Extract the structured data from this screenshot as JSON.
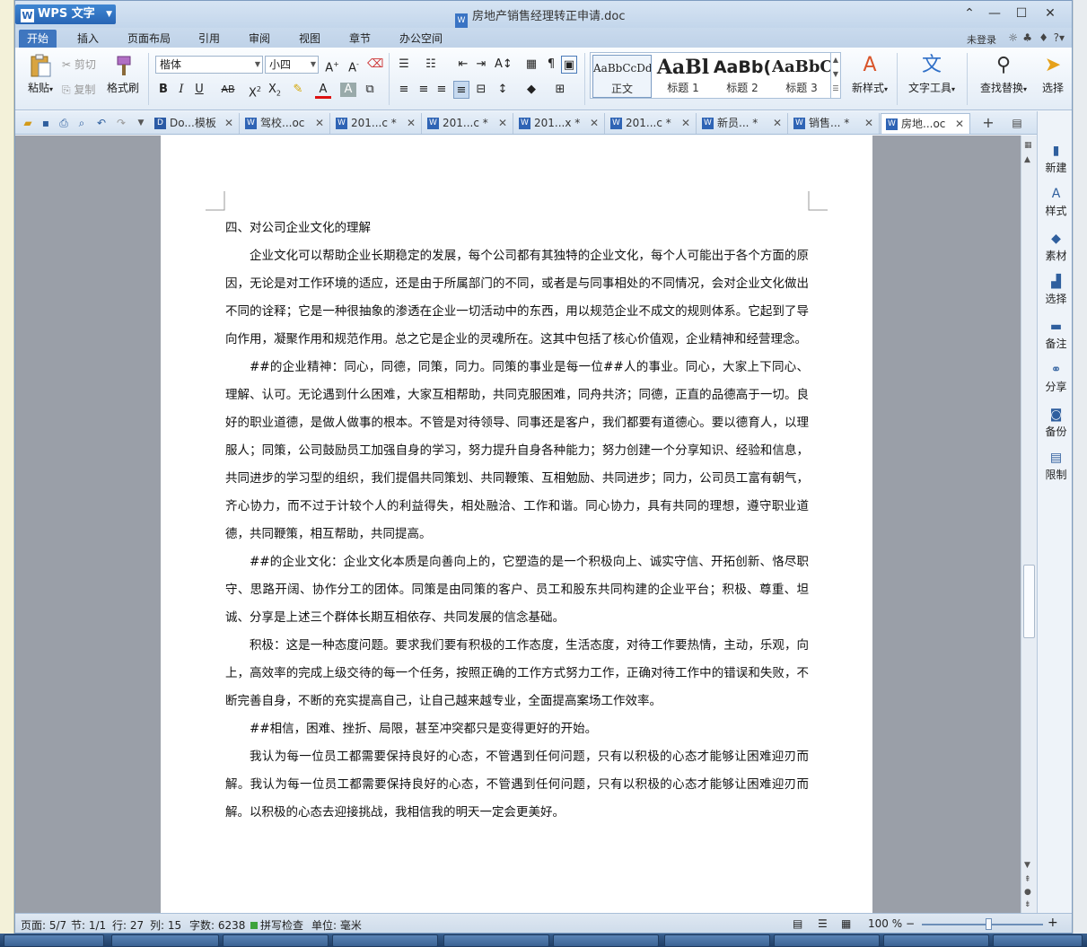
{
  "app": {
    "name": "WPS 文字",
    "document_title": "房地产销售经理转正申请.doc"
  },
  "menu": {
    "tabs": [
      "开始",
      "插入",
      "页面布局",
      "引用",
      "审阅",
      "视图",
      "章节",
      "办公空间"
    ],
    "active": "开始",
    "login": "未登录"
  },
  "ribbon": {
    "paste": "粘贴",
    "cut": "剪切",
    "copy": "复制",
    "format_painter": "格式刷",
    "font_name": "楷体",
    "font_size": "小四",
    "styles": [
      {
        "preview": "AaBbCcDd",
        "label": "正文"
      },
      {
        "preview": "AaBl",
        "label": "标题 1"
      },
      {
        "preview": "AaBb(",
        "label": "标题 2"
      },
      {
        "preview": "AaBbC",
        "label": "标题 3"
      }
    ],
    "new_style": "新样式",
    "text_tools": "文字工具",
    "find_replace": "查找替换",
    "select": "选择"
  },
  "doc_tabs": [
    {
      "label": "Do...模板",
      "active": false
    },
    {
      "label": "驾校...oc",
      "active": false
    },
    {
      "label": "201...c *",
      "active": false
    },
    {
      "label": "201...c *",
      "active": false
    },
    {
      "label": "201...x *",
      "active": false
    },
    {
      "label": "201...c *",
      "active": false
    },
    {
      "label": "新员... *",
      "active": false
    },
    {
      "label": "销售... *",
      "active": false
    },
    {
      "label": "房地...oc",
      "active": true
    }
  ],
  "document": {
    "heading": "四、对公司企业文化的理解",
    "paragraphs": [
      "企业文化可以帮助企业长期稳定的发展，每个公司都有其独特的企业文化，每个人可能出于各个方面的原因，无论是对工作环境的适应，还是由于所属部门的不同，或者是与同事相处的不同情况，会对企业文化做出不同的诠释；它是一种很抽象的渗透在企业一切活动中的东西，用以规范企业不成文的规则体系。它起到了导向作用，凝聚作用和规范作用。总之它是企业的灵魂所在。这其中包括了核心价值观，企业精神和经营理念。",
      "##的企业精神：同心，同德，同策，同力。同策的事业是每一位##人的事业。同心，大家上下同心、理解、认可。无论遇到什么困难，大家互相帮助，共同克服困难，同舟共济；同德，正直的品德高于一切。良好的职业道德，是做人做事的根本。不管是对待领导、同事还是客户，我们都要有道德心。要以德育人，以理服人；同策，公司鼓励员工加强自身的学习，努力提升自身各种能力；努力创建一个分享知识、经验和信息，共同进步的学习型的组织，我们提倡共同策划、共同鞭策、互相勉励、共同进步；同力，公司员工富有朝气，齐心协力，而不过于计较个人的利益得失，相处融洽、工作和谐。同心协力，具有共同的理想，遵守职业道德，共同鞭策，相互帮助，共同提高。",
      "##的企业文化：企业文化本质是向善向上的，它塑造的是一个积极向上、诚实守信、开拓创新、恪尽职守、思路开阔、协作分工的团体。同策是由同策的客户、员工和股东共同构建的企业平台；积极、尊重、坦诚、分享是上述三个群体长期互相依存、共同发展的信念基础。",
      "积极：这是一种态度问题。要求我们要有积极的工作态度，生活态度，对待工作要热情，主动，乐观，向上，高效率的完成上级交待的每一个任务，按照正确的工作方式努力工作，正确对待工作中的错误和失败，不断完善自身，不断的充实提高自己，让自己越来越专业，全面提高案场工作效率。",
      "##相信，困难、挫折、局限，甚至冲突都只是变得更好的开始。",
      "我认为每一位员工都需要保持良好的心态，不管遇到任何问题，只有以积极的心态才能够让困难迎刃而解。我认为每一位员工都需要保持良好的心态，不管遇到任何问题，只有以积极的心态才能够让困难迎刃而解。以积极的心态去迎接挑战，我相信我的明天一定会更美好。"
    ]
  },
  "taskpane": [
    "新建",
    "样式",
    "素材",
    "选择",
    "备注",
    "分享",
    "备份",
    "限制"
  ],
  "status": {
    "page": "页面: 5/7",
    "section": "节: 1/1",
    "row": "行: 27",
    "col": "列: 15",
    "words": "字数: 6238",
    "spell": "拼写检查",
    "unit": "单位: 毫米",
    "zoom": "100 %",
    "zoom_level": 0.55
  }
}
